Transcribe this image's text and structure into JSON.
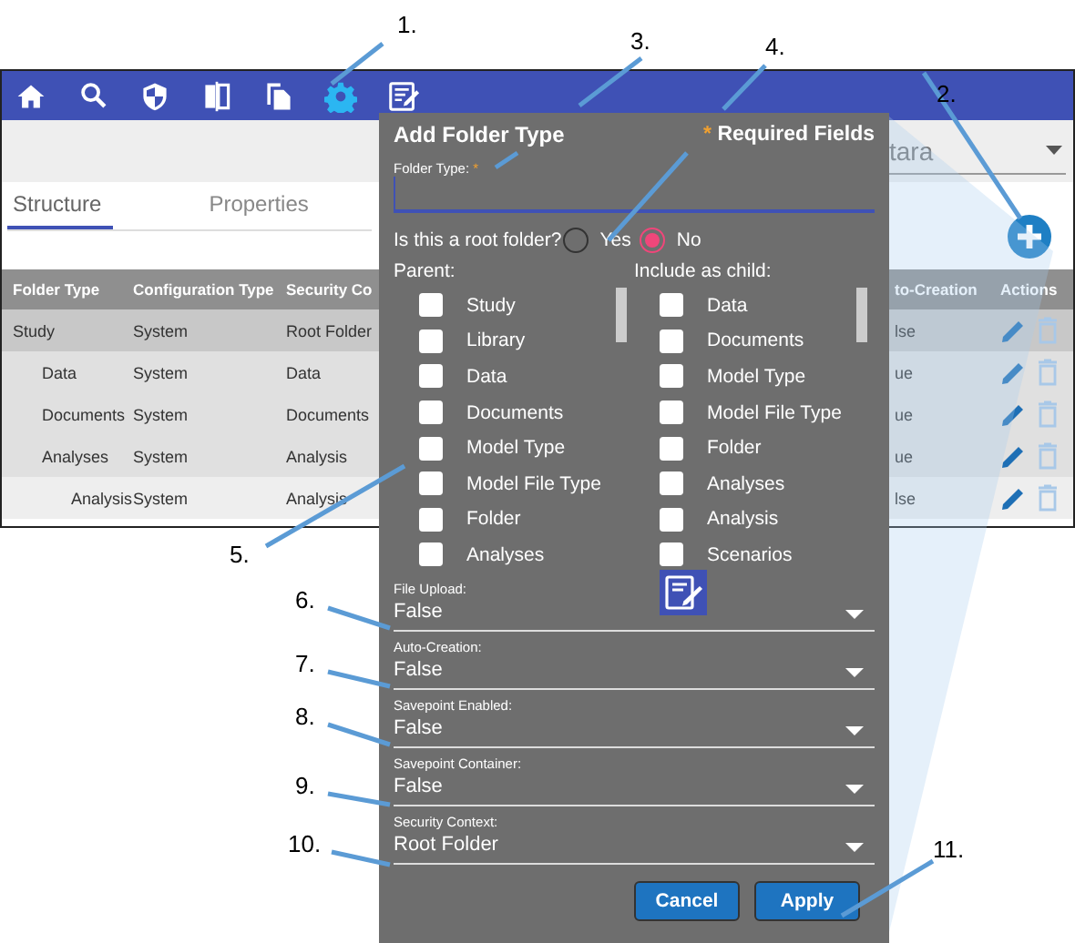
{
  "toolbar": [
    {
      "selected": false
    },
    {
      "selected": false
    },
    {
      "selected": false
    },
    {
      "selected": false
    },
    {
      "selected": false
    },
    {
      "selected": true
    },
    {
      "selected": false
    }
  ],
  "project_select": {
    "value": "tara"
  },
  "tabs": [
    {
      "label": "Structure",
      "selected": true
    },
    {
      "label": "Properties",
      "selected": false
    }
  ],
  "table": {
    "columns": [
      "Folder Type",
      "Configuration Type",
      "Security Co",
      "to-Creation",
      "Actions"
    ],
    "rows": [
      {
        "folder_type": "Study",
        "configuration_type": "System",
        "security_context": "Root Folder",
        "auto_creation": "lse",
        "selected": true,
        "children": [
          {
            "folder_type": "Data",
            "configuration_type": "System",
            "security_context": "Data",
            "auto_creation": "ue",
            "selected": false
          },
          {
            "folder_type": "Documents",
            "configuration_type": "System",
            "security_context": "Documents",
            "auto_creation": "ue",
            "selected": false
          },
          {
            "folder_type": "Analyses",
            "configuration_type": "System",
            "security_context": "Analysis",
            "auto_creation": "ue",
            "selected": false,
            "children": [
              {
                "folder_type": "Analysis",
                "configuration_type": "System",
                "security_context": "Analysis",
                "auto_creation": "lse",
                "selected": false
              }
            ]
          }
        ]
      }
    ]
  },
  "dialog": {
    "title": "Add Folder Type",
    "required_mark": "*",
    "required_note": "Required Fields",
    "folder_type_field": {
      "label": "Folder Type:",
      "required_mark": "*"
    },
    "root_question": {
      "label": "Is this a root folder?",
      "options": [
        {
          "label": "Yes",
          "selected": false
        },
        {
          "label": "No",
          "selected": true
        }
      ]
    },
    "parent": {
      "label": "Parent:",
      "items": [
        {
          "label": "Study",
          "checked": false
        },
        {
          "label": "Library",
          "checked": false
        },
        {
          "label": "Data",
          "checked": false
        },
        {
          "label": "Documents",
          "checked": false
        },
        {
          "label": "Model Type",
          "checked": false
        },
        {
          "label": "Model File Type",
          "checked": false
        },
        {
          "label": "Folder",
          "checked": false
        },
        {
          "label": "Analyses",
          "checked": false
        }
      ]
    },
    "include_as_child": {
      "label": "Include as child:",
      "items": [
        {
          "label": "Data",
          "checked": false
        },
        {
          "label": "Documents",
          "checked": false
        },
        {
          "label": "Model Type",
          "checked": false
        },
        {
          "label": "Model File Type",
          "checked": false
        },
        {
          "label": "Folder",
          "checked": false
        },
        {
          "label": "Analyses",
          "checked": false
        },
        {
          "label": "Analysis",
          "checked": false
        },
        {
          "label": "Scenarios",
          "checked": false
        }
      ]
    },
    "selects": [
      {
        "label": "File Upload:",
        "value": "False"
      },
      {
        "label": "Auto-Creation:",
        "value": "False"
      },
      {
        "label": "Savepoint Enabled:",
        "value": "False"
      },
      {
        "label": "Savepoint Container:",
        "value": "False"
      },
      {
        "label": "Security Context:",
        "value": "Root Folder"
      }
    ],
    "buttons": [
      {
        "label": "Cancel"
      },
      {
        "label": "Apply"
      }
    ]
  },
  "callouts": [
    "1.",
    "2.",
    "3.",
    "4.",
    "5.",
    "6.",
    "7.",
    "8.",
    "9.",
    "10.",
    "11."
  ]
}
